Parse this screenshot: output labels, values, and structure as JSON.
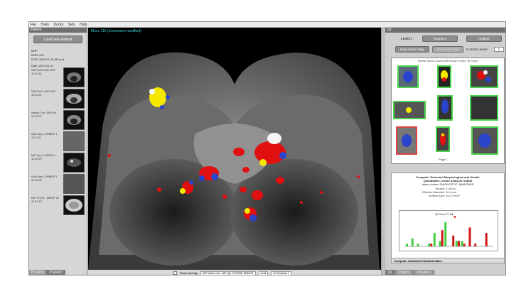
{
  "menu": [
    "File",
    "Tools",
    "Docks",
    "Sets",
    "Help"
  ],
  "left": {
    "panel_title": "Patient",
    "load_button": "Load New Patient",
    "patient_lines": [
      "MRP",
      "MRN: 012",
      "DOB: 1900-01-26 (59 yrs)"
    ],
    "date_line": "Date: 2013-01-01",
    "series": [
      {
        "label": "WIP Dix0 1000 BRP",
        "time": "12:20:41"
      },
      {
        "label": "WIP Dix0 1000 BRP",
        "time": "12:20:41"
      },
      {
        "label": "Motion Corr. WIP dix",
        "time": "12:43:07"
      },
      {
        "label": "sSub dyn_2 WMOP 1",
        "time": "12:43:11"
      },
      {
        "label": "MIP dyn_2 WMOP 1",
        "time": "12:49:22"
      },
      {
        "label": "sSub dyn_2 WMOP 1",
        "time": "12:49:22"
      },
      {
        "label": "MIP VISTA - WMOP 1E",
        "time": "12:51:15"
      }
    ],
    "tabs": [
      "Exams",
      "Patient"
    ]
  },
  "viewer": {
    "label": "Moco 110 (conversion modified)",
    "toolbar": {
      "show_overlay": "Show Overlay",
      "series_select": "MIP Motion Corr. WIP dyn t1TRISSE BREAST",
      "orientation": "Axial",
      "colormap": "EnhContrast 1"
    }
  },
  "right": {
    "panel_title": "QI",
    "lesion_label": "Lesion:",
    "segment_button": "Segment",
    "analyze_button": "Analyze",
    "hide_map_button": "Hide Kinetic Map",
    "show_map_button": "Show Ktm Map",
    "current_lesion_label": "Current Lesion:",
    "current_lesion_value": "1",
    "gallery_title": "Similar Saved Cases with Known Truths: QI Score",
    "page_label": "Page 1",
    "report": {
      "title1": "Computer Extracted Morphological and Kinetic",
      "title2": "Quantitative Lesion Analysis Output",
      "lesion": "Index Lesion: DIAGNOSTIC: NMA PNES",
      "volume_label": "Volume:",
      "volume": "0.154 cc",
      "diameter_label": "Effective Diameter:",
      "diameter": "10.4 mm",
      "surface_label": "Surface Area:",
      "surface": "1117.0 mm²",
      "qi_label": "QI Score™",
      "qi_value": "44",
      "characteristics": "Computer extracted Characteristics"
    },
    "tabs": [
      "QI",
      "Plugins",
      "Visualize"
    ]
  },
  "hist": {
    "green": [
      1,
      3,
      1,
      0,
      1,
      5,
      2,
      9,
      0,
      2,
      2,
      0,
      0,
      0,
      0,
      0
    ],
    "red": [
      0,
      0,
      0,
      0,
      1,
      0,
      6,
      0,
      4,
      2,
      1,
      7,
      1,
      0,
      5,
      0
    ]
  }
}
